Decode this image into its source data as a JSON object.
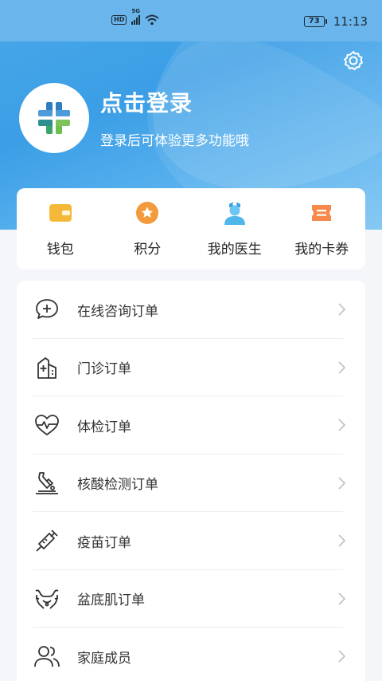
{
  "status": {
    "network_badge": "HD",
    "network_type": "5G",
    "battery": "73",
    "time": "11:13"
  },
  "header": {
    "login_title": "点击登录",
    "login_subtitle": "登录后可体验更多功能哦",
    "settings_icon": "gear-icon",
    "avatar_icon": "app-logo-cross"
  },
  "quick": {
    "items": [
      {
        "label": "钱包",
        "icon": "wallet-icon"
      },
      {
        "label": "积分",
        "icon": "points-star-icon"
      },
      {
        "label": "我的医生",
        "icon": "doctor-icon"
      },
      {
        "label": "我的卡券",
        "icon": "coupon-icon"
      }
    ]
  },
  "menu": {
    "items": [
      {
        "label": "在线咨询订单",
        "icon": "chat-plus-icon"
      },
      {
        "label": "门诊订单",
        "icon": "hospital-icon"
      },
      {
        "label": "体检订单",
        "icon": "heart-pulse-icon"
      },
      {
        "label": "核酸检测订单",
        "icon": "swab-test-icon"
      },
      {
        "label": "疫苗订单",
        "icon": "syringe-icon"
      },
      {
        "label": "盆底肌订单",
        "icon": "pelvis-icon"
      },
      {
        "label": "家庭成员",
        "icon": "family-icon"
      }
    ]
  },
  "colors": {
    "header_blue": "#3b9ee6",
    "wallet": "#f5b93a",
    "points": "#f39b3c",
    "doctor": "#4fb7ec",
    "coupon": "#f7894a"
  }
}
